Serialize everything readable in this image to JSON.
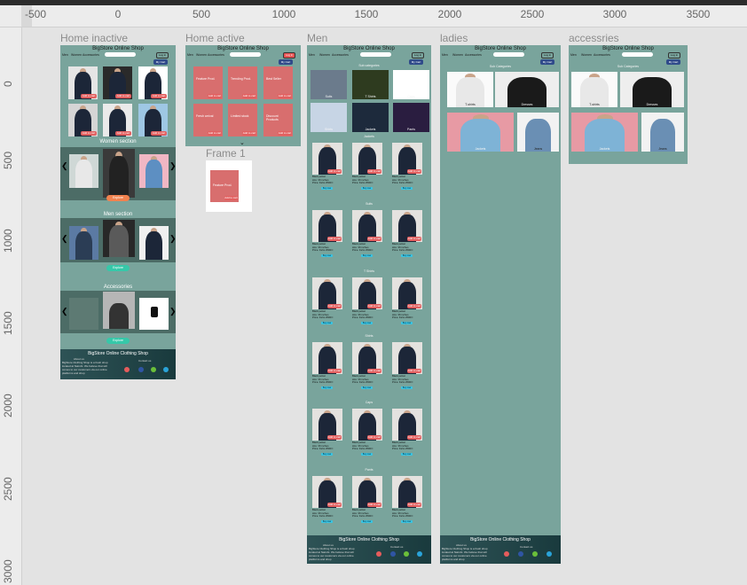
{
  "rulers": {
    "top": [
      "-500",
      "0",
      "500",
      "1000",
      "1500",
      "2000",
      "2500",
      "3000",
      "3500"
    ],
    "left": [
      "0",
      "500",
      "1000",
      "1500",
      "2000",
      "2500",
      "3000"
    ]
  },
  "frames": {
    "home_inactive": {
      "title": "Home inactive"
    },
    "home_active": {
      "title": "Home active"
    },
    "frame1": {
      "title": "Frame 1"
    },
    "men": {
      "title": "Men"
    },
    "ladies": {
      "title": "ladies"
    },
    "accessories": {
      "title": "accessries"
    }
  },
  "site": {
    "name": "BigStore Online Shop",
    "nav": [
      "Men",
      "Women",
      "Accessories"
    ],
    "login": "Log in",
    "cart": "My Cart",
    "footer_title": "BigStore Online Clothing Shop",
    "about_heading": "About us",
    "contact_heading": "Contact us",
    "about_text": "BigStore Clothing Shop is a fresh shop located at Nairobi. We believe that will  comes to our customers via our online platforms and shop"
  },
  "home": {
    "add_to_cart": "Add to cart",
    "women_section": "Women section",
    "men_section": "Men section",
    "accessories_section": "Accessories",
    "explore": "Explore",
    "pink_cards": [
      "Feature Prod.",
      "Trending Prod.",
      "Best Seller",
      "Fresh arrival",
      "Limited stock",
      "Discount Products"
    ]
  },
  "men": {
    "sub_categories": "Sub categories",
    "categories": [
      "Jackets",
      "Suits",
      "T Shirts",
      "Shirts",
      "Caps",
      "Pants"
    ],
    "thumbs": [
      "Suits",
      "T Shirts",
      "Caps",
      "Shirts",
      "Jackets",
      "Pants"
    ],
    "product": {
      "name": "Black jacket",
      "size": "size: 36 inches",
      "price": "Price: Kshs 2500/="
    },
    "buy_now": "Buy now"
  },
  "ladies": {
    "sub_categories": "Sub Categories",
    "tiles": [
      "T-shirts",
      "Dresses",
      "Jackets",
      "Jeans"
    ]
  },
  "colors": {
    "frame_bg": "#79a49c",
    "band": "#4c6c66",
    "pink": "#d86e6e",
    "orange": "#f1824f",
    "teal": "#36c8a9",
    "cyan": "#38c6e4",
    "cart": "#2f4a8a"
  }
}
